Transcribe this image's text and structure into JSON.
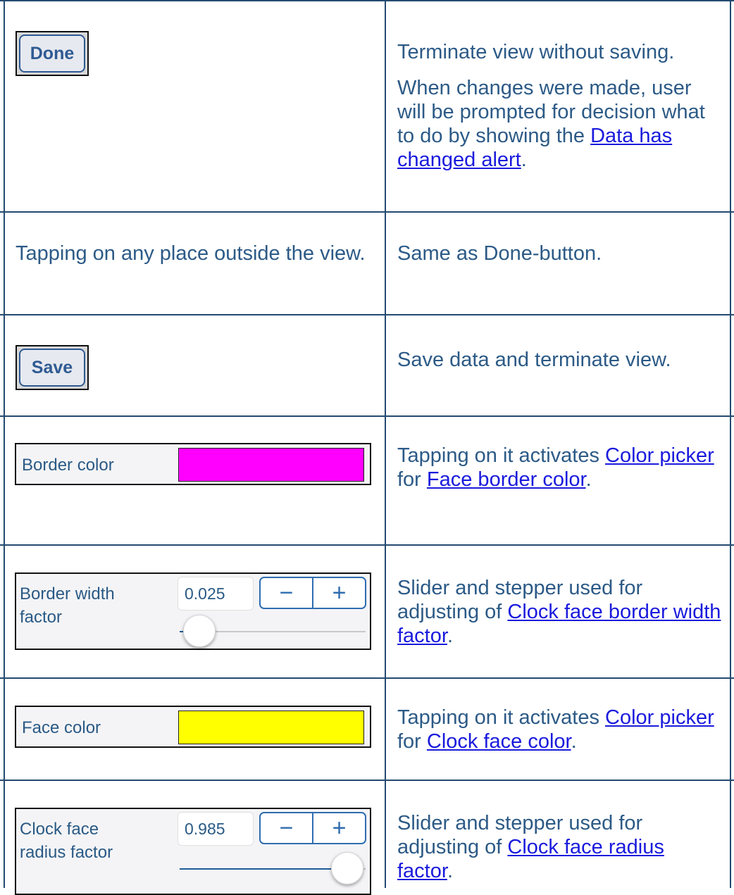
{
  "rows": [
    {
      "button_label": "Done",
      "desc_p1": "Terminate view without saving.",
      "desc_p2_pre": "When changes were made, user will be prompted for decision what to do by showing the ",
      "desc_p2_link": "Data has changed alert",
      "desc_p2_post": "."
    },
    {
      "left_text": "Tapping on any place outside the view.",
      "desc": "Same as Done-button."
    },
    {
      "button_label": "Save",
      "desc": "Save data and terminate view."
    },
    {
      "label": "Border color",
      "swatch_color": "#ff00ff",
      "desc_pre": "Tapping on it activates ",
      "desc_link1": "Color picker",
      "desc_mid": " for ",
      "desc_link2": "Face border color",
      "desc_post": "."
    },
    {
      "label": "Border width factor",
      "value": "0.025",
      "stepper_minus": "−",
      "stepper_plus": "+",
      "slider_fraction": 0.025,
      "desc_pre": "Slider and stepper used for adjusting of ",
      "desc_link": "Clock face border width factor",
      "desc_post": "."
    },
    {
      "label": "Face color",
      "swatch_color": "#ffff00",
      "desc_pre": "Tapping on it activates ",
      "desc_link1": "Color picker",
      "desc_mid": " for ",
      "desc_link2": "Clock face color",
      "desc_post": "."
    },
    {
      "label": "Clock face radius factor",
      "value": "0.985",
      "stepper_minus": "−",
      "stepper_plus": "+",
      "slider_fraction": 0.985,
      "desc_pre": "Slider and stepper used for adjusting of ",
      "desc_link": "Clock face radius factor",
      "desc_post": "."
    }
  ],
  "colors": {
    "grid_line": "#244a70",
    "text": "#2c5a86",
    "link": "#1a1add",
    "button_text": "#2f5b93"
  }
}
